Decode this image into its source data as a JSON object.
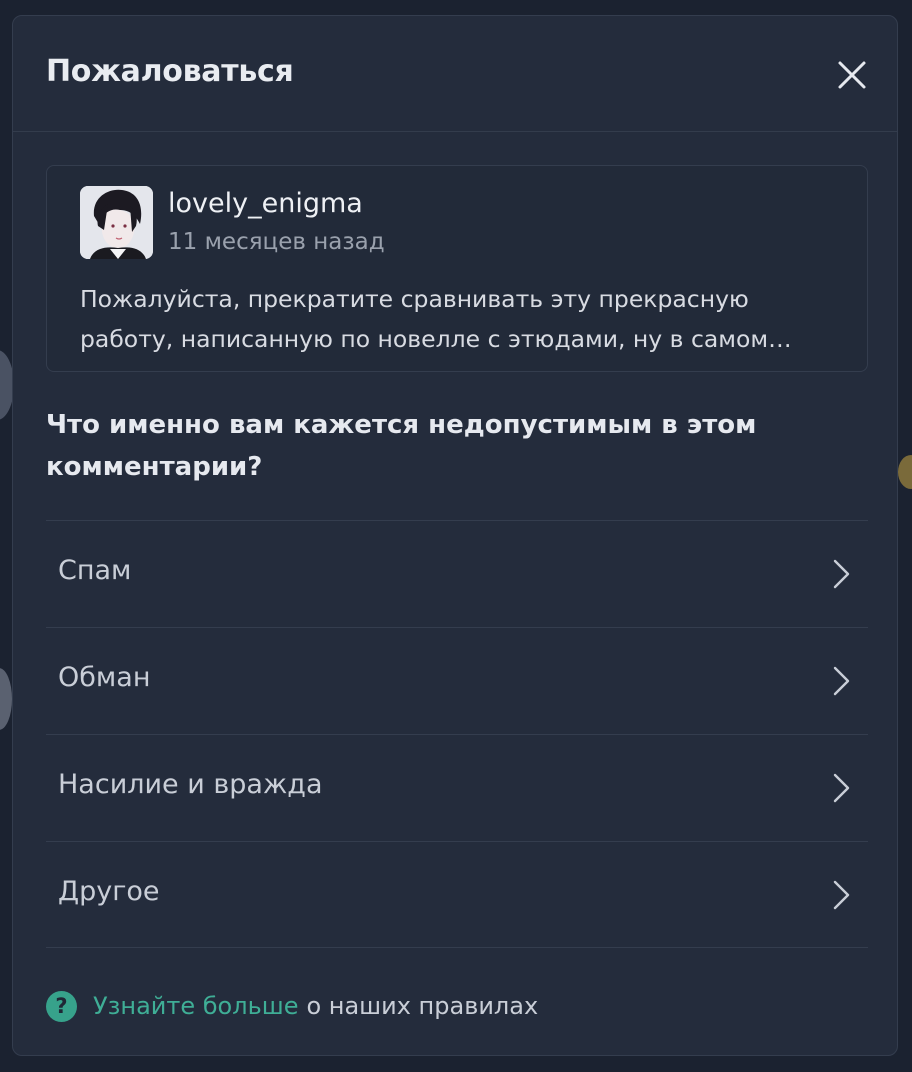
{
  "modal": {
    "title": "Пожаловаться"
  },
  "comment": {
    "username": "lovely_enigma",
    "timestamp": "11 месяцев назад",
    "text": "Пожалуйста, прекратите сравнивать эту прекрасную работу, написанную по новелле с этюдами, ну в самом…"
  },
  "question": "Что именно вам кажется недопустимым в этом комментарии?",
  "reasons": [
    {
      "label": "Спам"
    },
    {
      "label": "Обман"
    },
    {
      "label": "Насилие и вражда"
    },
    {
      "label": "Другое"
    }
  ],
  "footer": {
    "help_glyph": "?",
    "link_text": "Узнайте больше",
    "rest_text": "о наших правилах"
  },
  "colors": {
    "accent": "#3fae96",
    "modal_bg": "#242c3c",
    "overlay_bg": "#1b2230"
  },
  "icons": {
    "close": "close-icon",
    "chevron": "chevron-right-icon",
    "help": "question-circle-icon"
  }
}
